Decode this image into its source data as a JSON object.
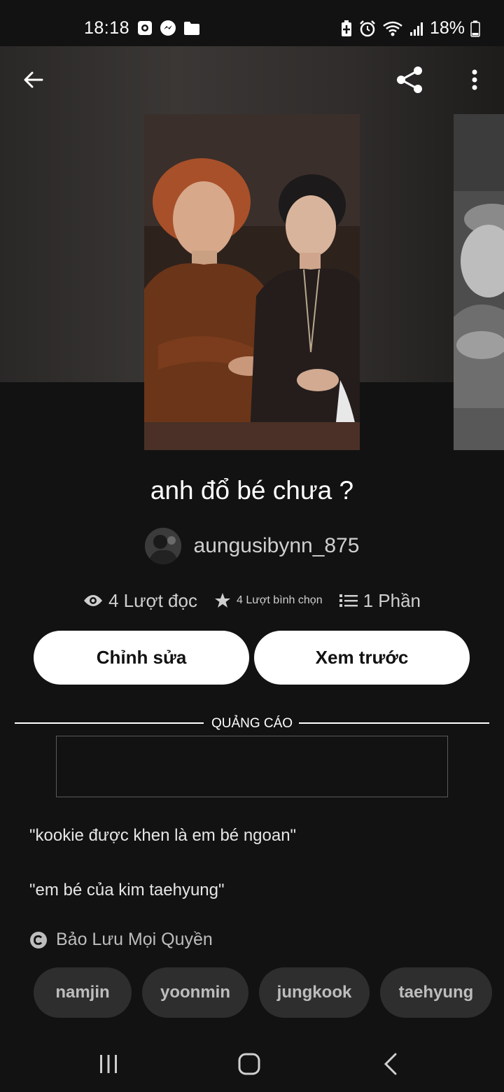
{
  "status": {
    "time": "18:18",
    "battery": "18%",
    "left_icons": [
      "notification-app-icon",
      "messenger-icon",
      "folder-icon"
    ],
    "right_icons": [
      "battery-saver-icon",
      "alarm-icon",
      "wifi-icon",
      "signal-icon",
      "battery-icon"
    ]
  },
  "toolbar": {
    "back_icon": "back-arrow-icon",
    "share_icon": "share-icon",
    "more_icon": "more-vertical-icon"
  },
  "story": {
    "title": "anh đổ bé chưa ?",
    "author": "aungusibynn_875",
    "stats": {
      "reads": "4 Lượt đọc",
      "votes": "4 Lượt bình chọn",
      "parts": "1 Phần"
    },
    "edit_label": "Chỉnh sửa",
    "preview_label": "Xem trước"
  },
  "ad": {
    "label": "QUẢNG CÁO"
  },
  "description": [
    "\"kookie được khen là em bé ngoan\"",
    "\"em bé của kim taehyung\""
  ],
  "copyright": "Bảo Lưu Mọi Quyền",
  "tags": [
    "namjin",
    "yoonmin",
    "jungkook",
    "taehyung"
  ],
  "colors": {
    "background": "#121212",
    "button": "#ffffff",
    "tag_bg": "#2e2e2e"
  },
  "navigation": {
    "recent_icon": "recent-apps-icon",
    "home_icon": "home-icon",
    "back_icon": "nav-back-icon"
  }
}
